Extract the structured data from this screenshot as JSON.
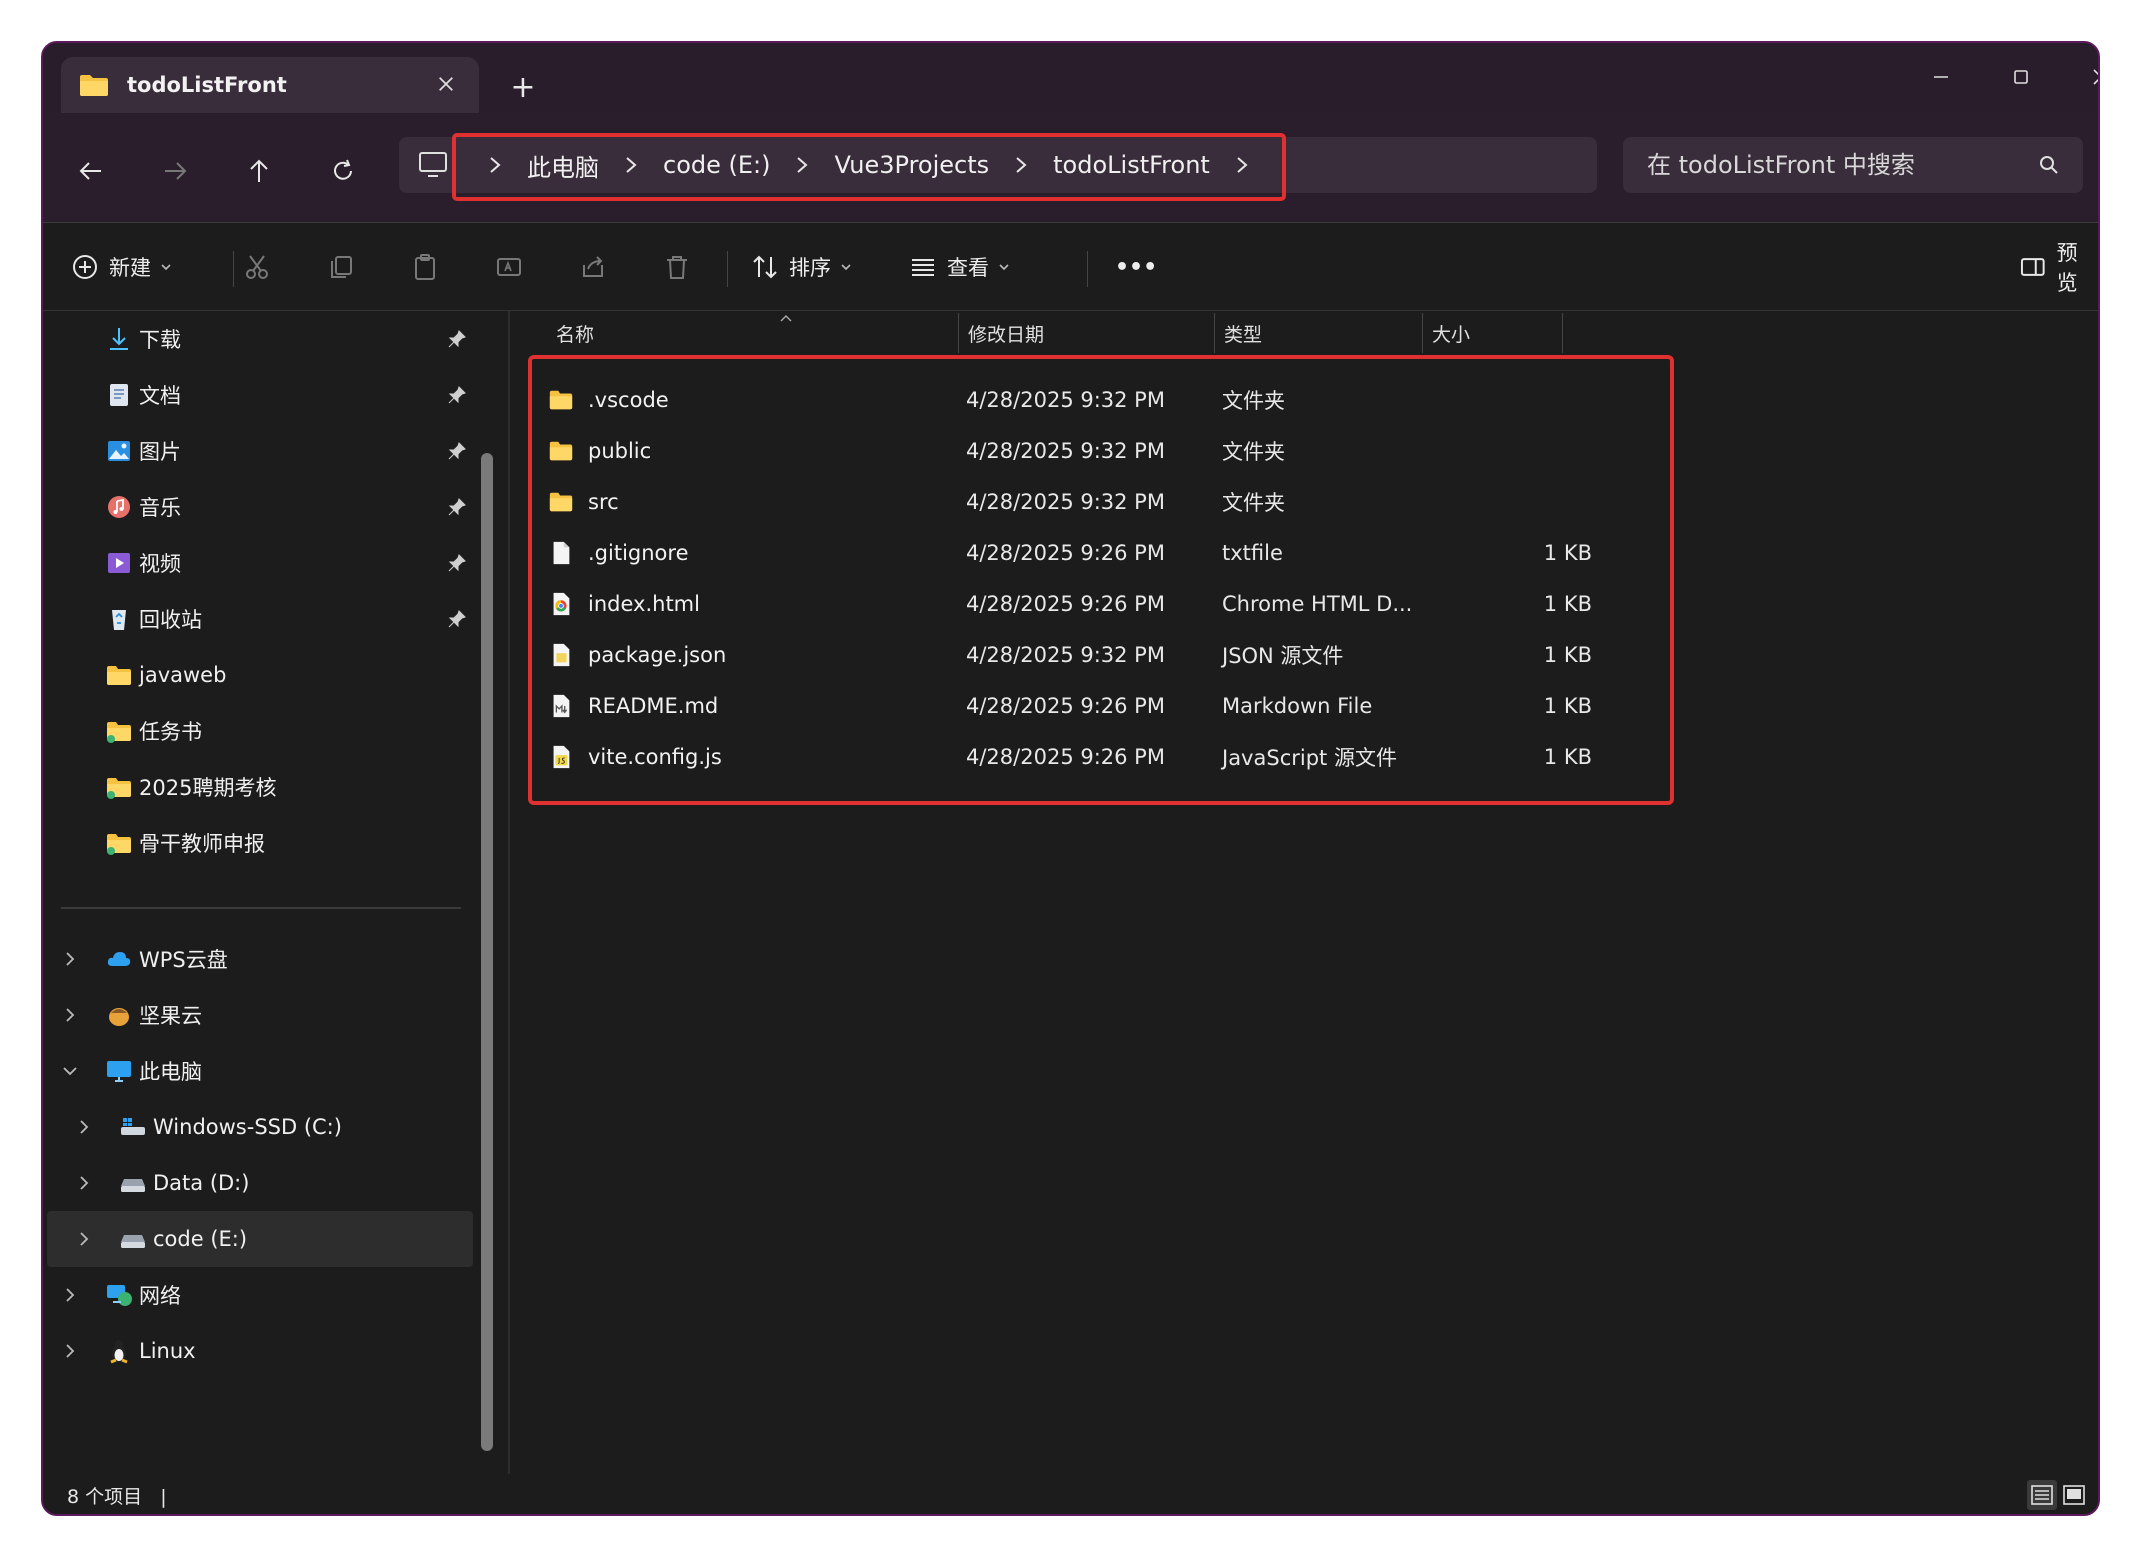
{
  "window": {
    "tab_title": "todoListFront",
    "new_tab_symbol": "+"
  },
  "address": {
    "crumbs": [
      "此电脑",
      "code (E:)",
      "Vue3Projects",
      "todoListFront"
    ],
    "search_placeholder": "在 todoListFront 中搜索"
  },
  "commands": {
    "new_label": "新建",
    "sort_label": "排序",
    "view_label": "查看",
    "more_label": "•••",
    "preview_label": "预览"
  },
  "nav": {
    "quick_access": [
      {
        "label": "下载",
        "icon": "download-icon",
        "pinned": true
      },
      {
        "label": "文档",
        "icon": "documents-icon",
        "pinned": true
      },
      {
        "label": "图片",
        "icon": "pictures-icon",
        "pinned": true
      },
      {
        "label": "音乐",
        "icon": "music-icon",
        "pinned": true
      },
      {
        "label": "视频",
        "icon": "videos-icon",
        "pinned": true
      },
      {
        "label": "回收站",
        "icon": "recycle-bin-icon",
        "pinned": true
      },
      {
        "label": "javaweb",
        "icon": "folder-icon",
        "pinned": false
      },
      {
        "label": "任务书",
        "icon": "folder-icon",
        "pinned": false
      },
      {
        "label": "2025聘期考核",
        "icon": "folder-icon",
        "pinned": false
      },
      {
        "label": "骨干教师申报",
        "icon": "folder-icon",
        "pinned": false
      }
    ],
    "tree": [
      {
        "label": "WPS云盘",
        "icon": "cloud-icon",
        "expanded": false,
        "level": 0
      },
      {
        "label": "坚果云",
        "icon": "nut-icon",
        "expanded": false,
        "level": 0
      },
      {
        "label": "此电脑",
        "icon": "computer-icon",
        "expanded": true,
        "level": 0
      },
      {
        "label": "Windows-SSD (C:)",
        "icon": "windows-drive-icon",
        "expanded": false,
        "level": 1
      },
      {
        "label": "Data (D:)",
        "icon": "drive-icon",
        "expanded": false,
        "level": 1
      },
      {
        "label": "code (E:)",
        "icon": "drive-icon",
        "expanded": false,
        "level": 1,
        "selected": true
      },
      {
        "label": "网络",
        "icon": "network-icon",
        "expanded": false,
        "level": 0
      },
      {
        "label": "Linux",
        "icon": "linux-icon",
        "expanded": false,
        "level": 0
      }
    ]
  },
  "columns": {
    "name": "名称",
    "date": "修改日期",
    "type": "类型",
    "size": "大小"
  },
  "files": [
    {
      "name": ".vscode",
      "date": "4/28/2025 9:32 PM",
      "type": "文件夹",
      "size": "",
      "icon": "folder-icon"
    },
    {
      "name": "public",
      "date": "4/28/2025 9:32 PM",
      "type": "文件夹",
      "size": "",
      "icon": "folder-icon"
    },
    {
      "name": "src",
      "date": "4/28/2025 9:32 PM",
      "type": "文件夹",
      "size": "",
      "icon": "folder-icon"
    },
    {
      "name": ".gitignore",
      "date": "4/28/2025 9:26 PM",
      "type": "txtfile",
      "size": "1 KB",
      "icon": "text-file-icon"
    },
    {
      "name": "index.html",
      "date": "4/28/2025 9:26 PM",
      "type": "Chrome HTML D...",
      "size": "1 KB",
      "icon": "chrome-html-icon"
    },
    {
      "name": "package.json",
      "date": "4/28/2025 9:32 PM",
      "type": "JSON 源文件",
      "size": "1 KB",
      "icon": "json-file-icon"
    },
    {
      "name": "README.md",
      "date": "4/28/2025 9:26 PM",
      "type": "Markdown File",
      "size": "1 KB",
      "icon": "markdown-file-icon"
    },
    {
      "name": "vite.config.js",
      "date": "4/28/2025 9:26 PM",
      "type": "JavaScript 源文件",
      "size": "1 KB",
      "icon": "js-file-icon"
    }
  ],
  "status": {
    "item_count": "8 个项目",
    "separator": "|"
  },
  "colors": {
    "highlight": "#e03030",
    "folder": "#f5c242",
    "chrome_accent": "#4285f4"
  }
}
